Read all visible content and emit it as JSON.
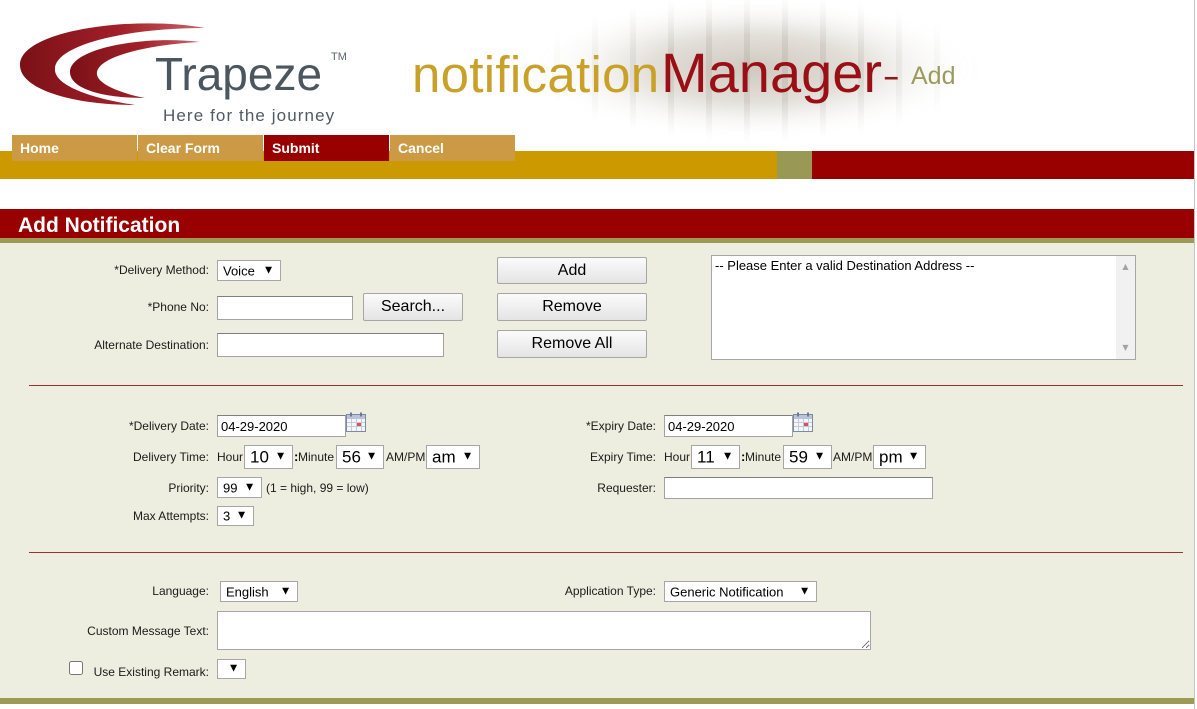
{
  "header": {
    "brand_name": "Trapeze",
    "trademark": "TM",
    "tagline": "Here for the journey",
    "app_title_part1": "notification",
    "app_title_part2": "Manager",
    "title_separator": "–",
    "page_mode": "Add"
  },
  "nav": {
    "items": [
      {
        "label": "Home",
        "highlighted": false
      },
      {
        "label": "Clear Form",
        "highlighted": false
      },
      {
        "label": "Submit",
        "highlighted": true
      },
      {
        "label": "Cancel",
        "highlighted": false
      }
    ]
  },
  "section": {
    "title": "Add Notification"
  },
  "form": {
    "delivery_method": {
      "label": "*Delivery Method:",
      "value": "Voice"
    },
    "phone_no": {
      "label": "*Phone No:",
      "value": ""
    },
    "search_button": {
      "label": "Search..."
    },
    "alternate_destination": {
      "label": "Alternate Destination:",
      "value": ""
    },
    "destination_buttons": {
      "add": "Add",
      "remove": "Remove",
      "remove_all": "Remove All"
    },
    "destination_list": {
      "items": [
        "-- Please Enter a valid Destination Address --"
      ]
    },
    "delivery_date": {
      "label": "*Delivery Date:",
      "value": "04-29-2020"
    },
    "expiry_date": {
      "label": "*Expiry Date:",
      "value": "04-29-2020"
    },
    "delivery_time": {
      "label": "Delivery Time:",
      "hour_label": "Hour",
      "hour": "10",
      "separator": ":",
      "minute_label": "Minute",
      "minute": "56",
      "ampm_label": "AM/PM",
      "ampm": "am"
    },
    "expiry_time": {
      "label": "Expiry Time:",
      "hour_label": "Hour",
      "hour": "11",
      "separator": ":",
      "minute_label": "Minute",
      "minute": "59",
      "ampm_label": "AM/PM",
      "ampm": "pm"
    },
    "priority": {
      "label": "Priority:",
      "value": "99",
      "hint": "(1 = high, 99 = low)"
    },
    "requester": {
      "label": "Requester:",
      "value": ""
    },
    "max_attempts": {
      "label": "Max Attempts:",
      "value": "3"
    },
    "language": {
      "label": "Language:",
      "value": "English"
    },
    "application_type": {
      "label": "Application Type:",
      "value": "Generic Notification"
    },
    "custom_message": {
      "label": "Custom Message Text:",
      "value": ""
    },
    "use_existing_remark": {
      "label": "Use Existing Remark:",
      "checked": false,
      "value": ""
    }
  },
  "icons": {
    "logo": "trapeze-swoosh-logo",
    "date_picker": "calendar-icon",
    "dropdown": "dropdown-arrow-icon",
    "scroll_up": "scroll-up-arrow-icon",
    "scroll_down": "scroll-down-arrow-icon"
  },
  "colors": {
    "primary_red": "#990000",
    "accent_gold": "#cc9900",
    "tab_tan": "#cc9a44",
    "olive": "#999955",
    "form_background": "#eeeee0",
    "title_gold": "#c9a128",
    "title_red": "#9a0e16",
    "divider": "#993333"
  }
}
